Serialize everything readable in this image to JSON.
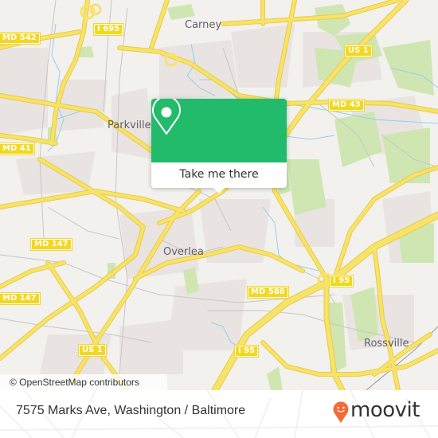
{
  "map": {
    "places": [
      {
        "name": "Carney",
        "id": "carney"
      },
      {
        "name": "Parkville",
        "id": "parkville"
      },
      {
        "name": "Overlea",
        "id": "overlea"
      },
      {
        "name": "Rossville",
        "id": "rossville"
      }
    ],
    "shields": [
      {
        "label": "MD 542",
        "id": "md-542"
      },
      {
        "label": "I 695",
        "id": "i-695"
      },
      {
        "label": "US 1",
        "id": "us-1-north"
      },
      {
        "label": "MD 43",
        "id": "md-43"
      },
      {
        "label": "MD 41",
        "id": "md-41"
      },
      {
        "label": "MD 147",
        "id": "md-147-a"
      },
      {
        "label": "MD 147",
        "id": "md-147-b"
      },
      {
        "label": "MD 588",
        "id": "md-588"
      },
      {
        "label": "I 95",
        "id": "i-95-east"
      },
      {
        "label": "US 1",
        "id": "us-1-south"
      },
      {
        "label": "I 95",
        "id": "i-95-south"
      }
    ],
    "attribution": "© OpenStreetMap contributors",
    "colors": {
      "land": "#f2f1ee",
      "road": "#f7e26b",
      "park": "#cfe6b2",
      "water": "#8fd0f0",
      "residential": "#e9e4e2"
    }
  },
  "popup": {
    "icon": "map-pin-icon",
    "button_label": "Take me there",
    "accent_color": "#22bb6b"
  },
  "footer": {
    "address": "7575 Marks Ave, Washington / Baltimore",
    "logo_text": "moovit",
    "logo_icon": "moovit-pin-icon",
    "logo_color": "#f26b3a"
  }
}
